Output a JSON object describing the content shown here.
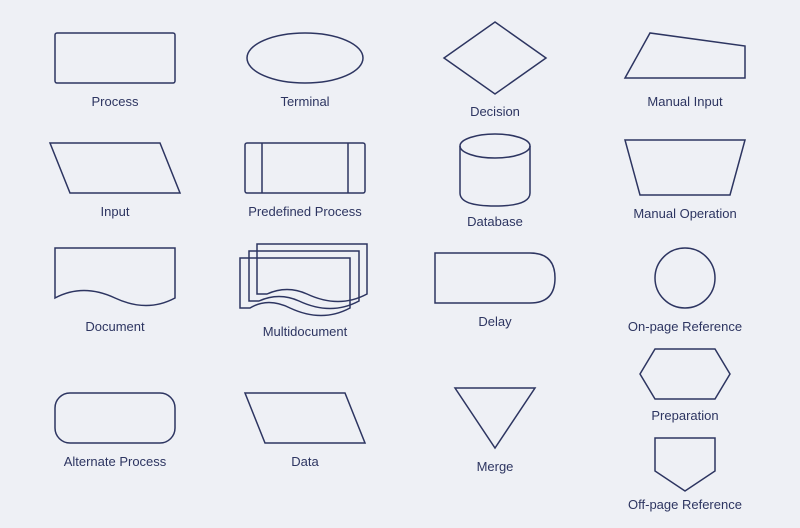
{
  "shapes": [
    {
      "id": "process",
      "label": "Process",
      "row": 1,
      "col": 1
    },
    {
      "id": "terminal",
      "label": "Terminal",
      "row": 1,
      "col": 2
    },
    {
      "id": "decision",
      "label": "Decision",
      "row": 1,
      "col": 3
    },
    {
      "id": "manual-input",
      "label": "Manual Input",
      "row": 1,
      "col": 4
    },
    {
      "id": "input",
      "label": "Input",
      "row": 2,
      "col": 1
    },
    {
      "id": "predefined-process",
      "label": "Predefined Process",
      "row": 2,
      "col": 2
    },
    {
      "id": "database",
      "label": "Database",
      "row": 2,
      "col": 3
    },
    {
      "id": "manual-operation",
      "label": "Manual Operation",
      "row": 2,
      "col": 4
    },
    {
      "id": "document",
      "label": "Document",
      "row": 3,
      "col": 1
    },
    {
      "id": "multidocument",
      "label": "Multidocument",
      "row": 3,
      "col": 2
    },
    {
      "id": "delay",
      "label": "Delay",
      "row": 3,
      "col": 3
    },
    {
      "id": "on-page-reference",
      "label": "On-page Reference",
      "row": 3,
      "col": 4
    },
    {
      "id": "alternate-process",
      "label": "Alternate Process",
      "row": 4,
      "col": 1
    },
    {
      "id": "data",
      "label": "Data",
      "row": 4,
      "col": 2
    },
    {
      "id": "merge",
      "label": "Merge",
      "row": 4,
      "col": 3
    },
    {
      "id": "preparation",
      "label": "Preparation",
      "row": 4,
      "col": 4
    },
    {
      "id": "off-page-reference",
      "label": "Off-page Reference",
      "row": 5,
      "col": 4
    }
  ]
}
